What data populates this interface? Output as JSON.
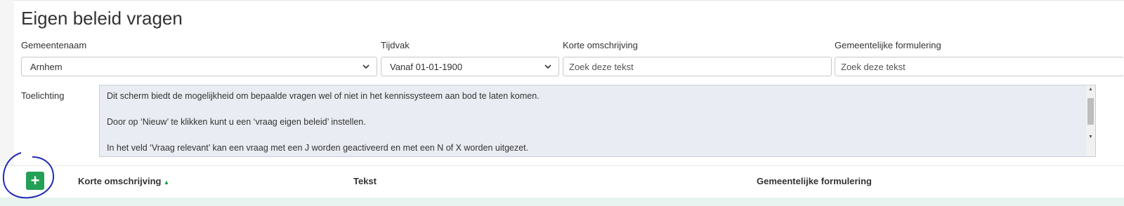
{
  "page": {
    "title": "Eigen beleid vragen"
  },
  "filters": {
    "gemeentenaam": {
      "label": "Gemeentenaam",
      "value": "Arnhem"
    },
    "tijdvak": {
      "label": "Tijdvak",
      "value": "Vanaf 01-01-1900"
    },
    "korte_omschrijving": {
      "label": "Korte omschrijving",
      "placeholder": "Zoek deze tekst"
    },
    "gemeentelijke_formulering": {
      "label": "Gemeentelijke formulering",
      "placeholder": "Zoek deze tekst"
    }
  },
  "toelichting": {
    "label": "Toelichting",
    "lines": [
      "Dit scherm biedt de mogelijkheid om bepaalde vragen wel of niet in het kennissysteem aan bod te laten komen.",
      "",
      "Door op ‘Nieuw’ te klikken kunt u een ‘vraag eigen beleid’ instellen.",
      "",
      "In het veld ‘Vraag relevant’ kan een vraag met een J worden geactiveerd en met een N of X worden uitgezet."
    ]
  },
  "table": {
    "add_button_symbol": "+",
    "columns": [
      "Korte omschrijving",
      "Tekst",
      "Gemeentelijke formulering"
    ],
    "sort_indicator": "▲"
  },
  "colors": {
    "accent": "#23a055",
    "annotation": "#1f2ab8"
  }
}
